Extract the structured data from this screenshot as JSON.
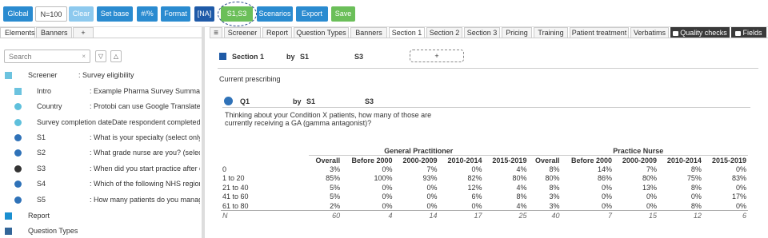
{
  "toolbar": {
    "global": "Global",
    "n_value": "N=100",
    "clear": "Clear",
    "set_base": "Set base",
    "hash_pct": "#/%",
    "format": "Format",
    "na": "[NA]",
    "active_filter": "S1,S3",
    "scenarios": "Scenarios",
    "export": "Export",
    "save": "Save"
  },
  "left_panel": {
    "tabs": [
      "Elements",
      "Banners",
      "+"
    ],
    "search_placeholder": "Search",
    "clear_glyph": "×",
    "filter_glyph": "▽",
    "sort_glyph": "△",
    "tree": [
      {
        "name": "Screener",
        "desc": ": Survey eligibility",
        "icon": "section-square-light"
      },
      {
        "name": "Intro",
        "desc": ": Example Pharma Survey Summary:",
        "icon": "item-square-light"
      },
      {
        "name": "Country",
        "desc": ": Protobi can use Google Translate to",
        "icon": "dot-light"
      },
      {
        "name": "Survey completion date",
        "desc": ": Date respondent completed",
        "icon": "dot-light"
      },
      {
        "name": "S1",
        "desc": ": What is your specialty (select only or",
        "icon": "dot-blue"
      },
      {
        "name": "S2",
        "desc": ": What grade nurse are you? (select o",
        "icon": "dot-blue"
      },
      {
        "name": "S3",
        "desc": ": When did you start practice after co",
        "icon": "dot-dark"
      },
      {
        "name": "S4",
        "desc": ": Which of the following NHS regions",
        "icon": "dot-blue"
      },
      {
        "name": "S5",
        "desc": ": How many patients do you manage",
        "icon": "dot-blue"
      },
      {
        "name": "Report",
        "desc": "",
        "icon": "section-square-blue"
      },
      {
        "name": "Question Types",
        "desc": "",
        "icon": "section-square-steel"
      }
    ]
  },
  "right_panel": {
    "menu_glyph": "≡",
    "tabs": [
      "Screener",
      "Report",
      "Question Types",
      "Banners",
      "Section 1",
      "Section 2",
      "Section 3",
      "Pricing",
      "Training",
      "Patient treatment",
      "Verbatims",
      "Quality checks",
      "Fields"
    ],
    "section_title": "Section 1",
    "by_label": "by",
    "section_s1": "S1",
    "section_s3": "S3",
    "plus": "+",
    "group_label": "Current prescribing",
    "question": {
      "id": "Q1",
      "by_label": "by",
      "s1": "S1",
      "s3": "S3",
      "text_line1": "Thinking about your Condition X patients, how many of those are",
      "text_line2": "currently receiving a GA (gamma antagonist)?"
    },
    "table": {
      "groups": [
        "General Practitioner",
        "Practice Nurse"
      ],
      "columns": [
        "Overall",
        "Before 2000",
        "2000-2009",
        "2010-2014",
        "2015-2019",
        "Overall",
        "Before 2000",
        "2000-2009",
        "2010-2014",
        "2015-2019"
      ],
      "rows": [
        {
          "label": "0",
          "values": [
            "3%",
            "0%",
            "7%",
            "0%",
            "4%",
            "8%",
            "14%",
            "7%",
            "8%",
            "0%"
          ]
        },
        {
          "label": "1 to 20",
          "values": [
            "85%",
            "100%",
            "93%",
            "82%",
            "80%",
            "80%",
            "86%",
            "80%",
            "75%",
            "83%"
          ]
        },
        {
          "label": "21 to 40",
          "values": [
            "5%",
            "0%",
            "0%",
            "12%",
            "4%",
            "8%",
            "0%",
            "13%",
            "8%",
            "0%"
          ]
        },
        {
          "label": "41 to 60",
          "values": [
            "5%",
            "0%",
            "0%",
            "6%",
            "8%",
            "3%",
            "0%",
            "0%",
            "0%",
            "17%"
          ]
        },
        {
          "label": "61 to 80",
          "values": [
            "2%",
            "0%",
            "0%",
            "0%",
            "4%",
            "3%",
            "0%",
            "0%",
            "8%",
            "0%"
          ]
        }
      ],
      "n_row": {
        "label": "N",
        "values": [
          "60",
          "4",
          "14",
          "17",
          "25",
          "40",
          "7",
          "15",
          "12",
          "6"
        ]
      }
    }
  },
  "colors": {
    "toolbar_blue": "#2a8bd0",
    "toolbar_light": "#8dc9ee",
    "toolbar_navy": "#1e5aa8",
    "toolbar_green": "#6bbf59",
    "dot_light": "#5fc0dc",
    "dot_blue": "#2f72b8",
    "dot_dark": "#333333",
    "square_light": "#6cc3df",
    "square_blue": "#1b8fd0",
    "square_steel": "#336699",
    "section_square": "#1f5aa6"
  }
}
